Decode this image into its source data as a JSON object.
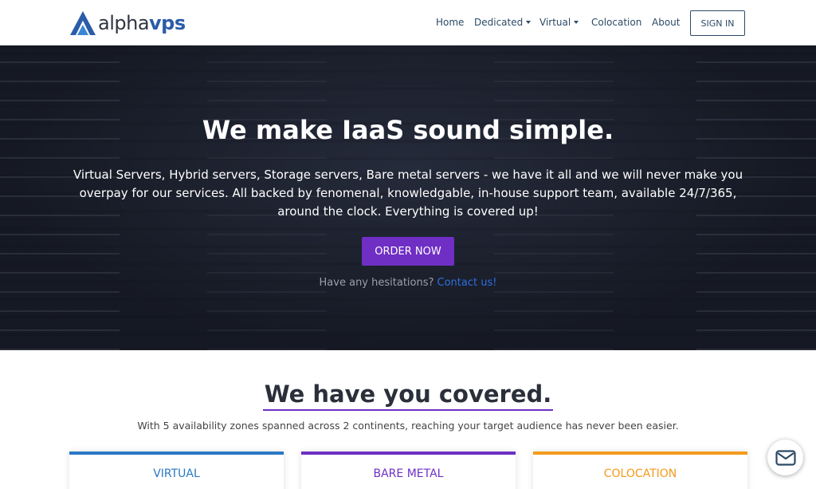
{
  "brand": {
    "logo_prefix": "alpha",
    "logo_suffix": "vps"
  },
  "nav": {
    "items": [
      {
        "label": "Home",
        "dropdown": false
      },
      {
        "label": "Dedicated",
        "dropdown": true
      },
      {
        "label": "Virtual",
        "dropdown": true
      },
      {
        "label": "Colocation",
        "dropdown": false
      },
      {
        "label": "About",
        "dropdown": false
      }
    ],
    "signin_label": "SIGN IN"
  },
  "hero": {
    "title": "We make IaaS sound simple.",
    "description": "Virtual Servers, Hybrid servers, Storage servers, Bare metal servers - we have it all and we will never make you overpay for our services. All backed by fenomenal, knowledgable, in-house support team, available 24/7/365, around the clock. Everything is covered up!",
    "order_label": "ORDER NOW",
    "hesitation_text": "Have any hesitations?",
    "contact_label": "Contact us!"
  },
  "covered": {
    "title": "We have you covered.",
    "subtitle": "With 5 availability zones spanned across 2 continents, reaching your target audience has never been easier."
  },
  "cards": [
    {
      "title": "VIRTUAL",
      "color": "#2b78c4"
    },
    {
      "title": "BARE METAL",
      "color": "#6f2fc4"
    },
    {
      "title": "COLOCATION",
      "color": "#f39a1d"
    }
  ],
  "icons": {
    "logo": "alphavps-logo-icon",
    "mail": "mail-icon"
  }
}
